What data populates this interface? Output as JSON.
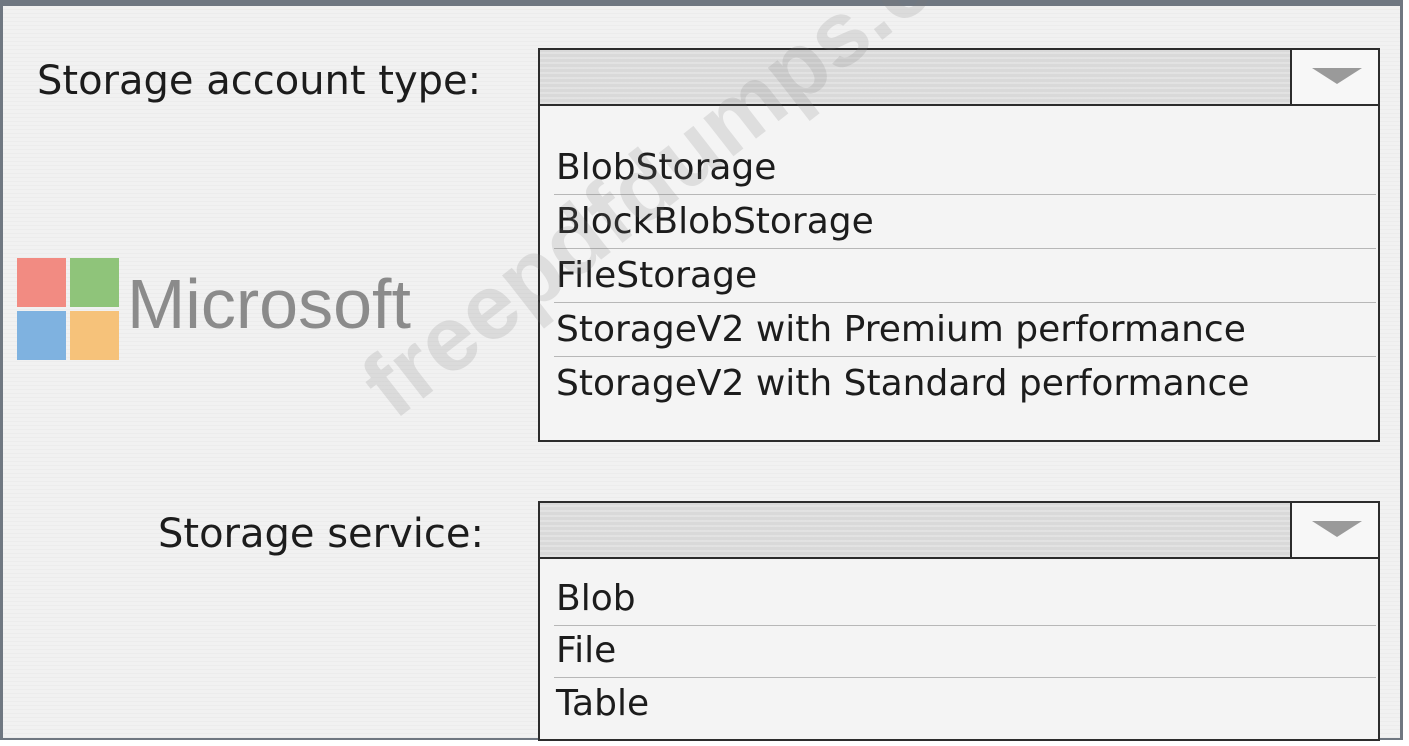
{
  "account_type": {
    "label": "Storage account type:",
    "options": [
      "BlobStorage",
      "BlockBlobStorage",
      "FileStorage",
      "StorageV2 with Premium performance",
      "StorageV2 with Standard performance"
    ]
  },
  "storage_service": {
    "label": "Storage service:",
    "options": [
      "Blob",
      "File",
      "Table"
    ]
  },
  "logo": {
    "text": "Microsoft",
    "colors": [
      "#f28b82",
      "#8fc47a",
      "#7fb2e0",
      "#f6c27a"
    ]
  },
  "watermark": "freepdfdumps.com"
}
